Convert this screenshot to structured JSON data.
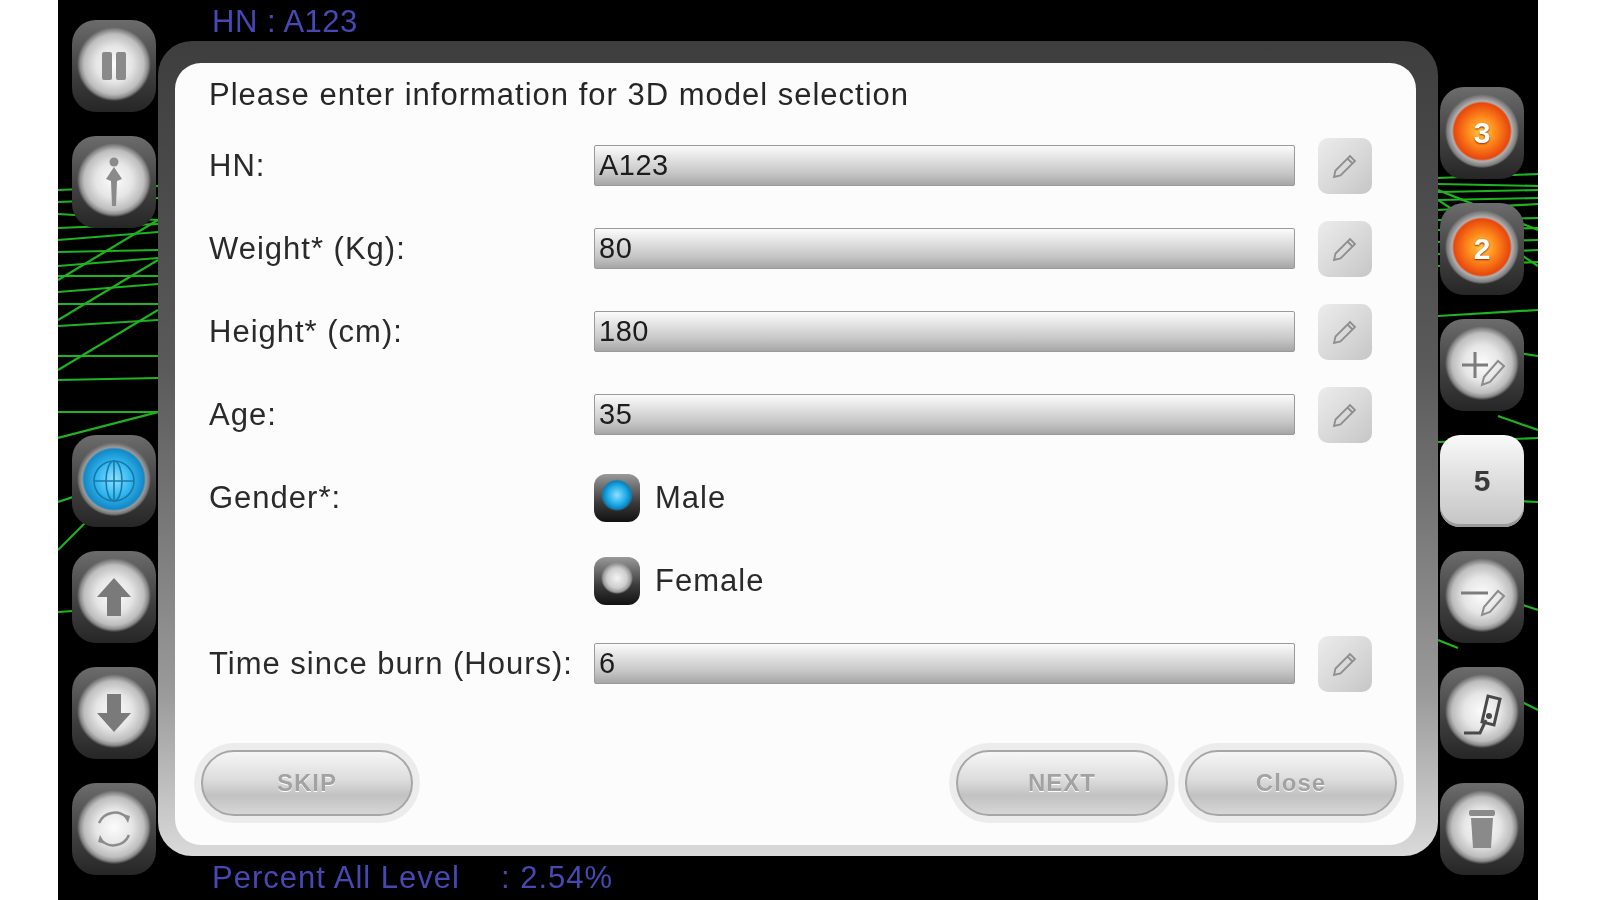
{
  "header": {
    "text": "HN : A123"
  },
  "left_toolbar": [
    {
      "selected": false
    },
    {
      "selected": false
    },
    {
      "selected": true
    },
    {
      "selected": false
    },
    {
      "selected": false
    },
    {
      "selected": false
    }
  ],
  "right_toolbar": [
    {
      "kind": "number",
      "label": "3"
    },
    {
      "kind": "number",
      "label": "2"
    },
    {
      "kind": "icon"
    },
    {
      "kind": "key",
      "label": "5"
    },
    {
      "kind": "icon"
    },
    {
      "kind": "icon"
    },
    {
      "kind": "icon"
    }
  ],
  "dialog": {
    "title": "Please enter information for 3D model selection",
    "fields": [
      {
        "kind": "text",
        "label": "HN:",
        "value": "A123"
      },
      {
        "kind": "text",
        "label": "Weight* (Kg):",
        "value": "80"
      },
      {
        "kind": "text",
        "label": "Height* (cm):",
        "value": "180"
      },
      {
        "kind": "text",
        "label": "Age:",
        "value": "35"
      },
      {
        "kind": "radio",
        "label": "Gender*:",
        "options": [
          {
            "label": "Male",
            "selected": true
          },
          {
            "label": "Female",
            "selected": false
          }
        ]
      },
      {
        "kind": "text",
        "label": "Time since burn (Hours):",
        "value": "6"
      }
    ],
    "buttons": [
      {
        "label": "SKIP",
        "disabled": true
      },
      {
        "label": "NEXT",
        "disabled": true
      },
      {
        "label": "Close",
        "disabled": true
      }
    ]
  },
  "footer": {
    "label": "Percent All Level",
    "value": ": 2.54%"
  }
}
